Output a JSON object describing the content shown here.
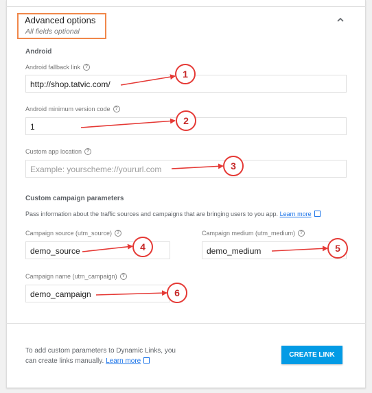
{
  "header": {
    "title": "Advanced options",
    "subtitle": "All fields optional"
  },
  "android": {
    "section_title": "Android",
    "fallback_label": "Android fallback link",
    "fallback_value": "http://shop.tatvic.com/",
    "min_version_label": "Android minimum version code",
    "min_version_value": "1",
    "custom_location_label": "Custom app location",
    "custom_location_placeholder": "Example: yourscheme://yoururl.com"
  },
  "campaign": {
    "section_title": "Custom campaign parameters",
    "description": "Pass information about the traffic sources and campaigns that are bringing users to you app.",
    "learn_more": "Learn more",
    "source_label": "Campaign source (utm_source)",
    "source_value": "demo_source",
    "medium_label": "Campaign medium (utm_medium)",
    "medium_value": "demo_medium",
    "name_label": "Campaign name (utm_campaign)",
    "name_value": "demo_campaign"
  },
  "footer": {
    "text_line1": "To add custom parameters to Dynamic Links, you",
    "text_line2": "can create links manually.",
    "learn_more": "Learn more",
    "button": "CREATE LINK"
  },
  "annotations": [
    "1",
    "2",
    "3",
    "4",
    "5",
    "6"
  ],
  "colors": {
    "highlight_box": "#f0874a",
    "annotation_red": "#e53935",
    "button_blue": "#039be5",
    "link_blue": "#1a73e8"
  }
}
